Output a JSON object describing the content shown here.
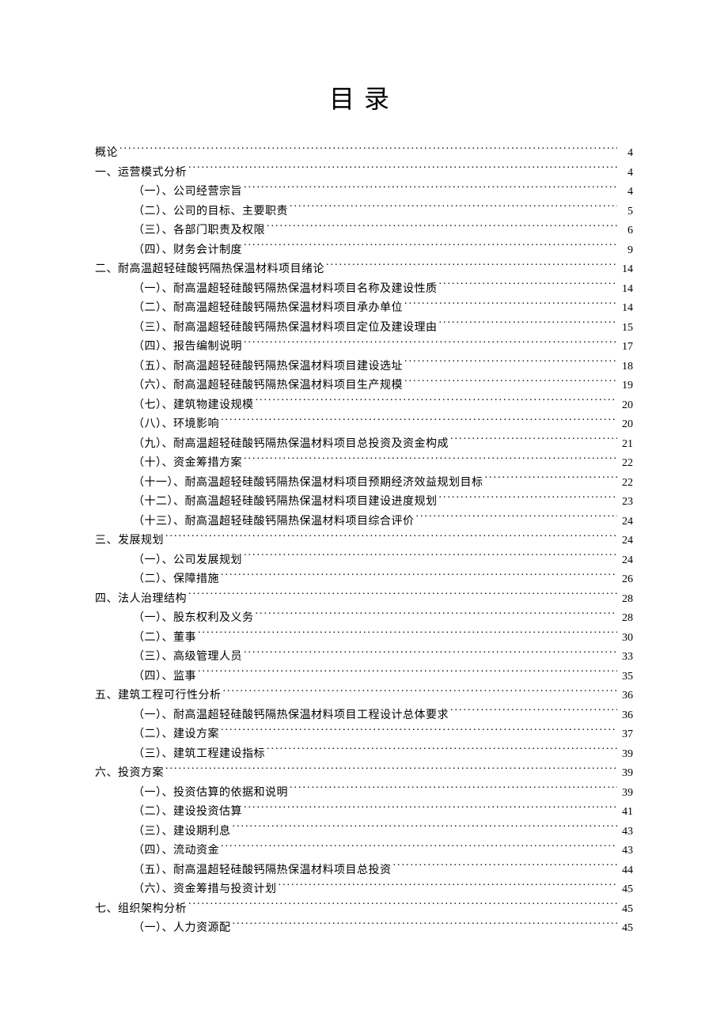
{
  "title": "目录",
  "toc": [
    {
      "level": 0,
      "label": "概论",
      "page": "4"
    },
    {
      "level": 0,
      "label": "一、运营模式分析",
      "page": "4"
    },
    {
      "level": 1,
      "label": "（一）、公司经营宗旨",
      "page": "4"
    },
    {
      "level": 1,
      "label": "（二）、公司的目标、主要职责",
      "page": "5"
    },
    {
      "level": 1,
      "label": "（三）、各部门职责及权限",
      "page": "6"
    },
    {
      "level": 1,
      "label": "（四）、财务会计制度",
      "page": "9"
    },
    {
      "level": 0,
      "label": "二、耐高温超轻硅酸钙隔热保温材料项目绪论",
      "page": "14"
    },
    {
      "level": 1,
      "label": "（一）、耐高温超轻硅酸钙隔热保温材料项目名称及建设性质",
      "page": "14"
    },
    {
      "level": 1,
      "label": "（二）、耐高温超轻硅酸钙隔热保温材料项目承办单位",
      "page": "14"
    },
    {
      "level": 1,
      "label": "（三）、耐高温超轻硅酸钙隔热保温材料项目定位及建设理由",
      "page": "15"
    },
    {
      "level": 1,
      "label": "（四）、报告编制说明",
      "page": "17"
    },
    {
      "level": 1,
      "label": "（五）、耐高温超轻硅酸钙隔热保温材料项目建设选址",
      "page": "18"
    },
    {
      "level": 1,
      "label": "（六）、耐高温超轻硅酸钙隔热保温材料项目生产规模",
      "page": "19"
    },
    {
      "level": 1,
      "label": "（七）、建筑物建设规模",
      "page": "20"
    },
    {
      "level": 1,
      "label": "（八）、环境影响",
      "page": "20"
    },
    {
      "level": 1,
      "label": "（九）、耐高温超轻硅酸钙隔热保温材料项目总投资及资金构成",
      "page": "21"
    },
    {
      "level": 1,
      "label": "（十）、资金筹措方案",
      "page": "22"
    },
    {
      "level": 1,
      "label": "（十一）、耐高温超轻硅酸钙隔热保温材料项目预期经济效益规划目标",
      "page": "22"
    },
    {
      "level": 1,
      "label": "（十二）、耐高温超轻硅酸钙隔热保温材料项目建设进度规划",
      "page": "23"
    },
    {
      "level": 1,
      "label": "（十三）、耐高温超轻硅酸钙隔热保温材料项目综合评价",
      "page": "24"
    },
    {
      "level": 0,
      "label": "三、发展规划",
      "page": "24"
    },
    {
      "level": 1,
      "label": "（一）、公司发展规划",
      "page": "24"
    },
    {
      "level": 1,
      "label": "（二）、保障措施",
      "page": "26"
    },
    {
      "level": 0,
      "label": "四、法人治理结构",
      "page": "28"
    },
    {
      "level": 1,
      "label": "（一）、股东权利及义务",
      "page": "28"
    },
    {
      "level": 1,
      "label": "（二）、董事",
      "page": "30"
    },
    {
      "level": 1,
      "label": "（三）、高级管理人员",
      "page": "33"
    },
    {
      "level": 1,
      "label": "（四）、监事",
      "page": "35"
    },
    {
      "level": 0,
      "label": "五、建筑工程可行性分析",
      "page": "36"
    },
    {
      "level": 1,
      "label": "（一）、耐高温超轻硅酸钙隔热保温材料项目工程设计总体要求",
      "page": "36"
    },
    {
      "level": 1,
      "label": "（二）、建设方案",
      "page": "37"
    },
    {
      "level": 1,
      "label": "（三）、建筑工程建设指标",
      "page": "39"
    },
    {
      "level": 0,
      "label": "六、投资方案",
      "page": "39"
    },
    {
      "level": 1,
      "label": "（一）、投资估算的依据和说明",
      "page": "39"
    },
    {
      "level": 1,
      "label": "（二）、建设投资估算",
      "page": "41"
    },
    {
      "level": 1,
      "label": "（三）、建设期利息",
      "page": "43"
    },
    {
      "level": 1,
      "label": "（四）、流动资金",
      "page": "43"
    },
    {
      "level": 1,
      "label": "（五）、耐高温超轻硅酸钙隔热保温材料项目总投资",
      "page": "44"
    },
    {
      "level": 1,
      "label": "（六）、资金筹措与投资计划",
      "page": "45"
    },
    {
      "level": 0,
      "label": "七、组织架构分析",
      "page": "45"
    },
    {
      "level": 1,
      "label": "（一）、人力资源配",
      "page": "45"
    }
  ]
}
